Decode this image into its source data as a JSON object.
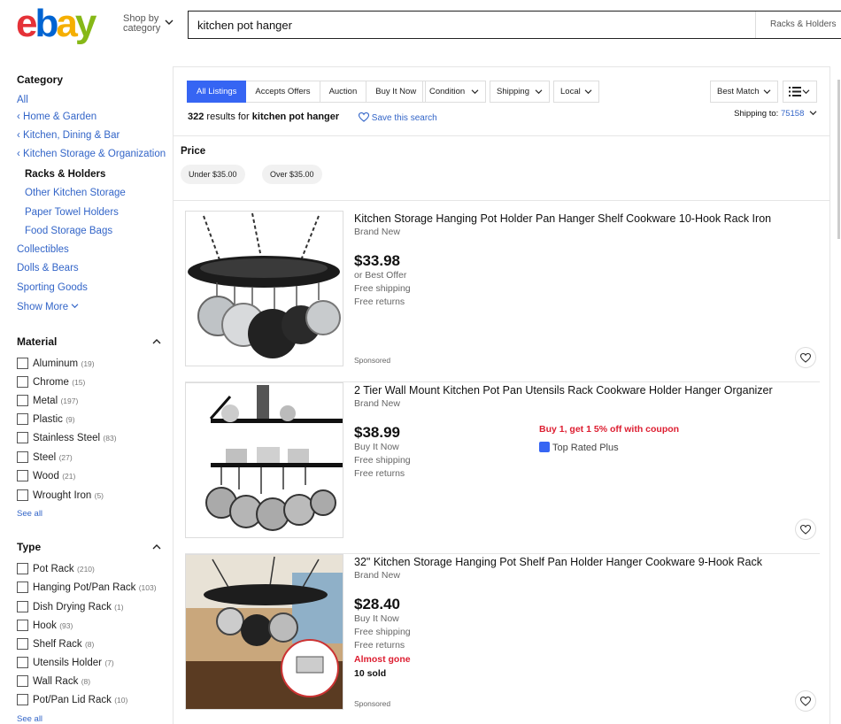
{
  "header": {
    "logo_letters": [
      {
        "ch": "e",
        "color": "#e53238"
      },
      {
        "ch": "b",
        "color": "#0064d2"
      },
      {
        "ch": "a",
        "color": "#f5af02"
      },
      {
        "ch": "y",
        "color": "#86b817"
      }
    ],
    "shop_by_line1": "Shop by",
    "shop_by_line2": "category",
    "search_value": "kitchen pot hanger",
    "search_category": "Racks & Holders"
  },
  "sidebar": {
    "category_heading": "Category",
    "category_links": [
      {
        "label": "All",
        "kind": "link"
      },
      {
        "label": "‹ Home & Garden",
        "kind": "link"
      },
      {
        "label": "‹ Kitchen, Dining & Bar",
        "kind": "link"
      },
      {
        "label": "‹ Kitchen Storage & Organization",
        "kind": "link"
      },
      {
        "label": "Racks & Holders",
        "kind": "current"
      },
      {
        "label": "Other Kitchen Storage",
        "kind": "sublink"
      },
      {
        "label": "Paper Towel Holders",
        "kind": "sublink"
      },
      {
        "label": "Food Storage Bags",
        "kind": "sublink"
      },
      {
        "label": "Collectibles",
        "kind": "link"
      },
      {
        "label": "Dolls & Bears",
        "kind": "link"
      },
      {
        "label": "Sporting Goods",
        "kind": "link"
      },
      {
        "label": "Show More",
        "kind": "link"
      }
    ],
    "material_heading": "Material",
    "material_options": [
      {
        "label": "Aluminum",
        "count": "(19)"
      },
      {
        "label": "Chrome",
        "count": "(15)"
      },
      {
        "label": "Metal",
        "count": "(197)"
      },
      {
        "label": "Plastic",
        "count": "(9)"
      },
      {
        "label": "Stainless Steel",
        "count": "(83)"
      },
      {
        "label": "Steel",
        "count": "(27)"
      },
      {
        "label": "Wood",
        "count": "(21)"
      },
      {
        "label": "Wrought Iron",
        "count": "(5)"
      }
    ],
    "see_all_1": "See all",
    "type_heading": "Type",
    "type_options": [
      {
        "label": "Pot Rack",
        "count": "(210)"
      },
      {
        "label": "Hanging Pot/Pan Rack",
        "count": "(103)"
      },
      {
        "label": "Dish Drying Rack",
        "count": "(1)"
      },
      {
        "label": "Hook",
        "count": "(93)"
      },
      {
        "label": "Shelf Rack",
        "count": "(8)"
      },
      {
        "label": "Utensils Holder",
        "count": "(7)"
      },
      {
        "label": "Wall Rack",
        "count": "(8)"
      },
      {
        "label": "Pot/Pan Lid Rack",
        "count": "(10)"
      }
    ],
    "see_all_2": "See all"
  },
  "toolbar": {
    "tabs": [
      "All Listings",
      "Accepts Offers",
      "Auction",
      "Buy It Now"
    ],
    "condition": "Condition",
    "shipping": "Shipping",
    "local": "Local",
    "sort": "Best Match",
    "results_count": "322",
    "results_text": " results for ",
    "results_query": "kitchen pot hanger",
    "save_search": "Save this search",
    "ship_to_label": "Shipping to: ",
    "ship_to_zip": "75158"
  },
  "price_filter": {
    "heading": "Price",
    "under": "Under $35.00",
    "over": "Over $35.00"
  },
  "listings": [
    {
      "title": "Kitchen Storage Hanging Pot Holder Pan Hanger Shelf Cookware 10-Hook Rack Iron",
      "condition": "Brand New",
      "price": "$33.98",
      "lines": [
        "or Best Offer",
        "Free shipping",
        "Free returns"
      ],
      "sponsored": "Sponsored"
    },
    {
      "title": "2 Tier Wall Mount Kitchen Pot Pan Utensils Rack Cookware Holder Hanger Organizer",
      "condition": "Brand New",
      "price": "$38.99",
      "lines": [
        "Buy It Now",
        "Free shipping",
        "Free returns"
      ],
      "promo": "Buy 1, get 1 5% off with coupon",
      "badge": "Top Rated Plus"
    },
    {
      "title": "32\" Kitchen Storage Hanging Pot Shelf Pan Holder Hanger Cookware 9-Hook Rack",
      "condition": "Brand New",
      "price": "$28.40",
      "lines": [
        "Buy It Now",
        "Free shipping",
        "Free returns"
      ],
      "urgency": "Almost gone",
      "sold": "10 sold",
      "sponsored": "Sponsored"
    }
  ],
  "colors": {
    "link": "#3365c8",
    "accent": "#3665f3",
    "alert": "#dd1e31"
  }
}
